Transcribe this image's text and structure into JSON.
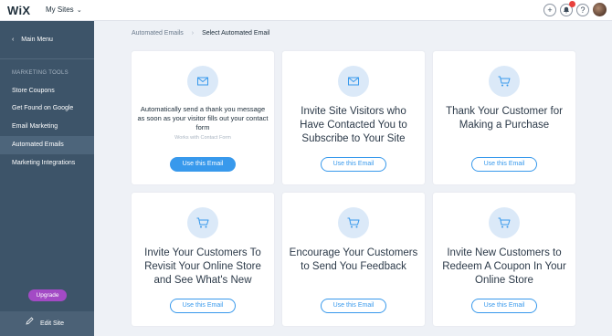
{
  "topbar": {
    "logo": "WiX",
    "sites_label": "My Sites",
    "chevron": "⌄",
    "add_glyph": "+",
    "bell_glyph": "🔔",
    "help_glyph": "?"
  },
  "sidebar": {
    "back_glyph": "‹",
    "main_menu": "Main Menu",
    "section_title": "MARKETING TOOLS",
    "items": [
      {
        "label": "Store Coupons"
      },
      {
        "label": "Get Found on Google"
      },
      {
        "label": "Email Marketing"
      },
      {
        "label": "Automated Emails"
      },
      {
        "label": "Marketing Integrations"
      }
    ],
    "upgrade": "Upgrade",
    "edit_site": "Edit Site"
  },
  "breadcrumb": {
    "parent": "Automated Emails",
    "separator": "›",
    "current": "Select Automated Email"
  },
  "cards": [
    {
      "title": "Automatically send a thank you message as soon as your visitor fills out your contact form",
      "subtitle": "Works with Contact Form",
      "button": "Use this Email",
      "icon": "envelope-icon"
    },
    {
      "title": "Invite Site Visitors who Have Contacted You to Subscribe to Your Site",
      "button": "Use this Email",
      "icon": "envelope-icon"
    },
    {
      "title": "Thank Your Customer for Making a Purchase",
      "button": "Use this Email",
      "icon": "cart-icon"
    },
    {
      "title": "Invite Your Customers To Revisit Your Online Store and See What's New",
      "button": "Use this Email",
      "icon": "cart-icon"
    },
    {
      "title": "Encourage Your Customers to Send You Feedback",
      "button": "Use this Email",
      "icon": "cart-icon"
    },
    {
      "title": "Invite New Customers to Redeem A Coupon In Your Online Store",
      "button": "Use this Email",
      "icon": "cart-icon"
    }
  ],
  "colors": {
    "accent": "#3899ec",
    "sidebar": "#3d5469",
    "upgrade": "#a34ac5",
    "badge": "#e8413d"
  }
}
